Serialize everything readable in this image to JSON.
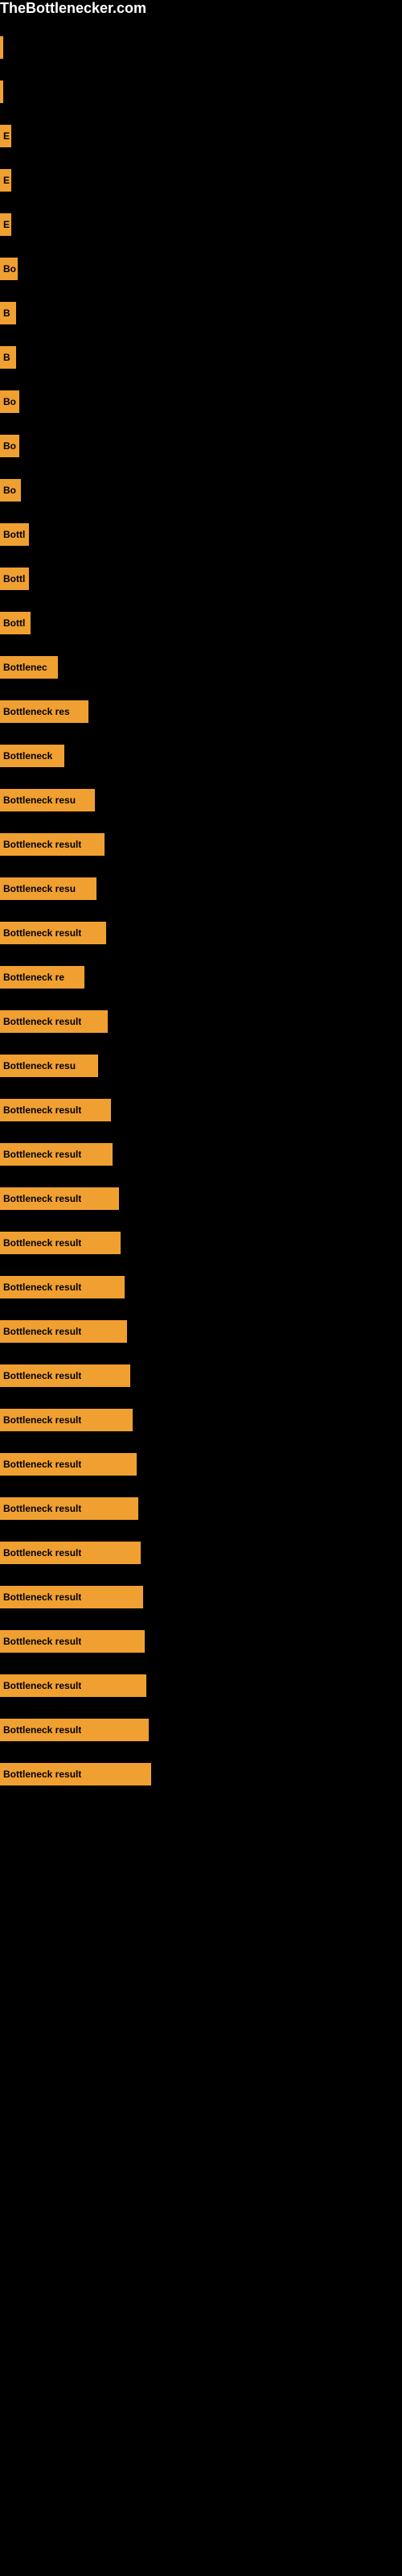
{
  "site": {
    "title": "TheBottlenecker.com"
  },
  "bars": [
    {
      "label": "",
      "width": 4
    },
    {
      "label": "",
      "width": 4
    },
    {
      "label": "E",
      "width": 14
    },
    {
      "label": "E",
      "width": 14
    },
    {
      "label": "E",
      "width": 14
    },
    {
      "label": "Bo",
      "width": 22
    },
    {
      "label": "B",
      "width": 20
    },
    {
      "label": "B",
      "width": 20
    },
    {
      "label": "Bo",
      "width": 24
    },
    {
      "label": "Bo",
      "width": 24
    },
    {
      "label": "Bo",
      "width": 26
    },
    {
      "label": "Bottl",
      "width": 36
    },
    {
      "label": "Bottl",
      "width": 36
    },
    {
      "label": "Bottl",
      "width": 38
    },
    {
      "label": "Bottlenec",
      "width": 72
    },
    {
      "label": "Bottleneck res",
      "width": 110
    },
    {
      "label": "Bottleneck",
      "width": 80
    },
    {
      "label": "Bottleneck resu",
      "width": 118
    },
    {
      "label": "Bottleneck result",
      "width": 130
    },
    {
      "label": "Bottleneck resu",
      "width": 120
    },
    {
      "label": "Bottleneck result",
      "width": 132
    },
    {
      "label": "Bottleneck re",
      "width": 105
    },
    {
      "label": "Bottleneck result",
      "width": 134
    },
    {
      "label": "Bottleneck resu",
      "width": 122
    },
    {
      "label": "Bottleneck result",
      "width": 138
    },
    {
      "label": "Bottleneck result",
      "width": 140
    },
    {
      "label": "Bottleneck result",
      "width": 148
    },
    {
      "label": "Bottleneck result",
      "width": 150
    },
    {
      "label": "Bottleneck result",
      "width": 155
    },
    {
      "label": "Bottleneck result",
      "width": 158
    },
    {
      "label": "Bottleneck result",
      "width": 162
    },
    {
      "label": "Bottleneck result",
      "width": 165
    },
    {
      "label": "Bottleneck result",
      "width": 170
    },
    {
      "label": "Bottleneck result",
      "width": 172
    },
    {
      "label": "Bottleneck result",
      "width": 175
    },
    {
      "label": "Bottleneck result",
      "width": 178
    },
    {
      "label": "Bottleneck result",
      "width": 180
    },
    {
      "label": "Bottleneck result",
      "width": 182
    },
    {
      "label": "Bottleneck result",
      "width": 185
    },
    {
      "label": "Bottleneck result",
      "width": 188
    }
  ]
}
